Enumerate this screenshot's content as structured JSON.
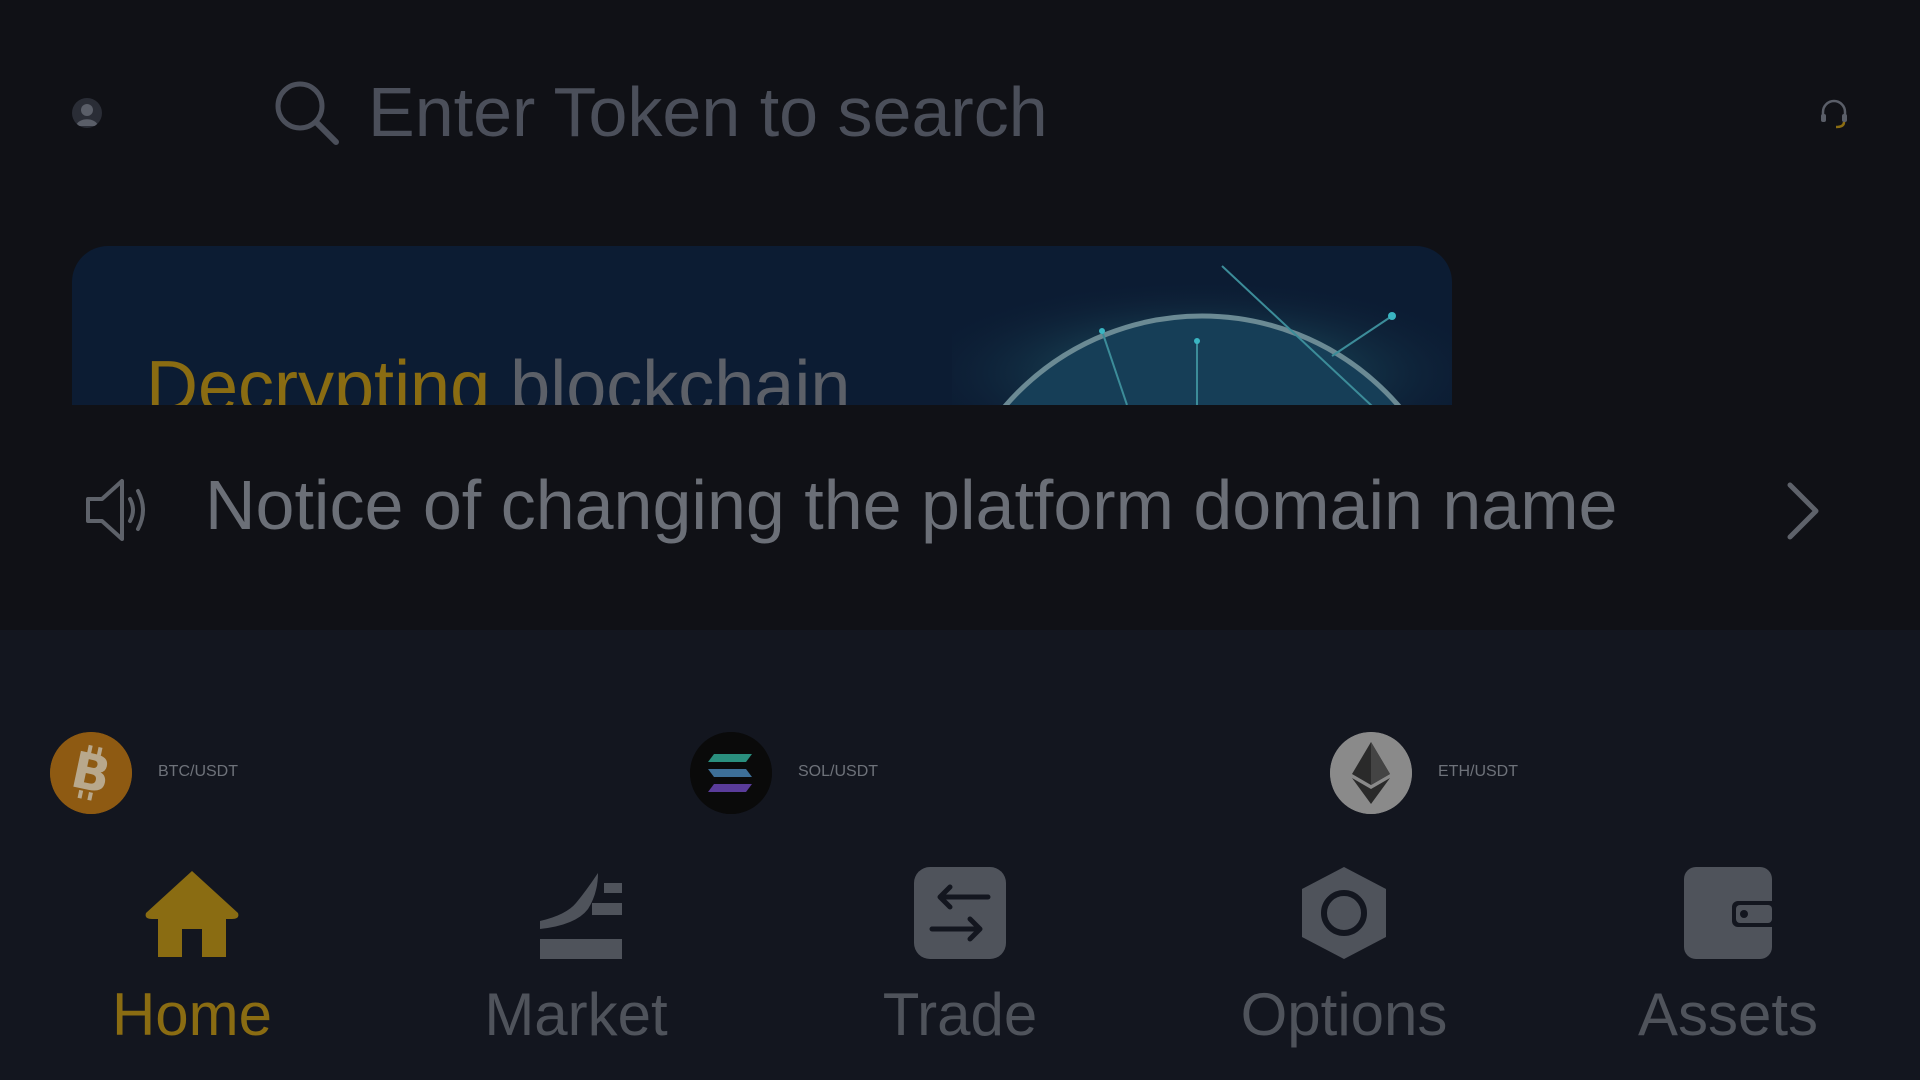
{
  "header": {
    "search_placeholder": "Enter Token to search",
    "icons": [
      "avatar",
      "search-icon",
      "headset-icon"
    ]
  },
  "banner": {
    "title_gold": "Decrypting",
    "title_white": "blockchain"
  },
  "notice": {
    "text": "Notice of changing the platform domain name",
    "icons": [
      "speaker-icon",
      "chevron-right-icon"
    ]
  },
  "tickers": [
    {
      "pair": "BTC/USDT",
      "coin": "bitcoin-icon",
      "color": "#8e5a12"
    },
    {
      "pair": "SOL/USDT",
      "coin": "solana-icon",
      "color": "#0a0a0a"
    },
    {
      "pair": "ETH/USDT",
      "coin": "ethereum-icon",
      "color": "#8a8a8a"
    }
  ],
  "tabbar": {
    "items": [
      {
        "label": "Home",
        "icon": "home-icon",
        "active": true
      },
      {
        "label": "Market",
        "icon": "market-icon",
        "active": false
      },
      {
        "label": "Trade",
        "icon": "trade-icon",
        "active": false
      },
      {
        "label": "Options",
        "icon": "options-icon",
        "active": false
      },
      {
        "label": "Assets",
        "icon": "wallet-icon",
        "active": false
      }
    ]
  },
  "colors": {
    "accent": "#8a6c12",
    "background": "#13161f",
    "header_bg": "#101116",
    "muted_text": "#4f535b"
  }
}
